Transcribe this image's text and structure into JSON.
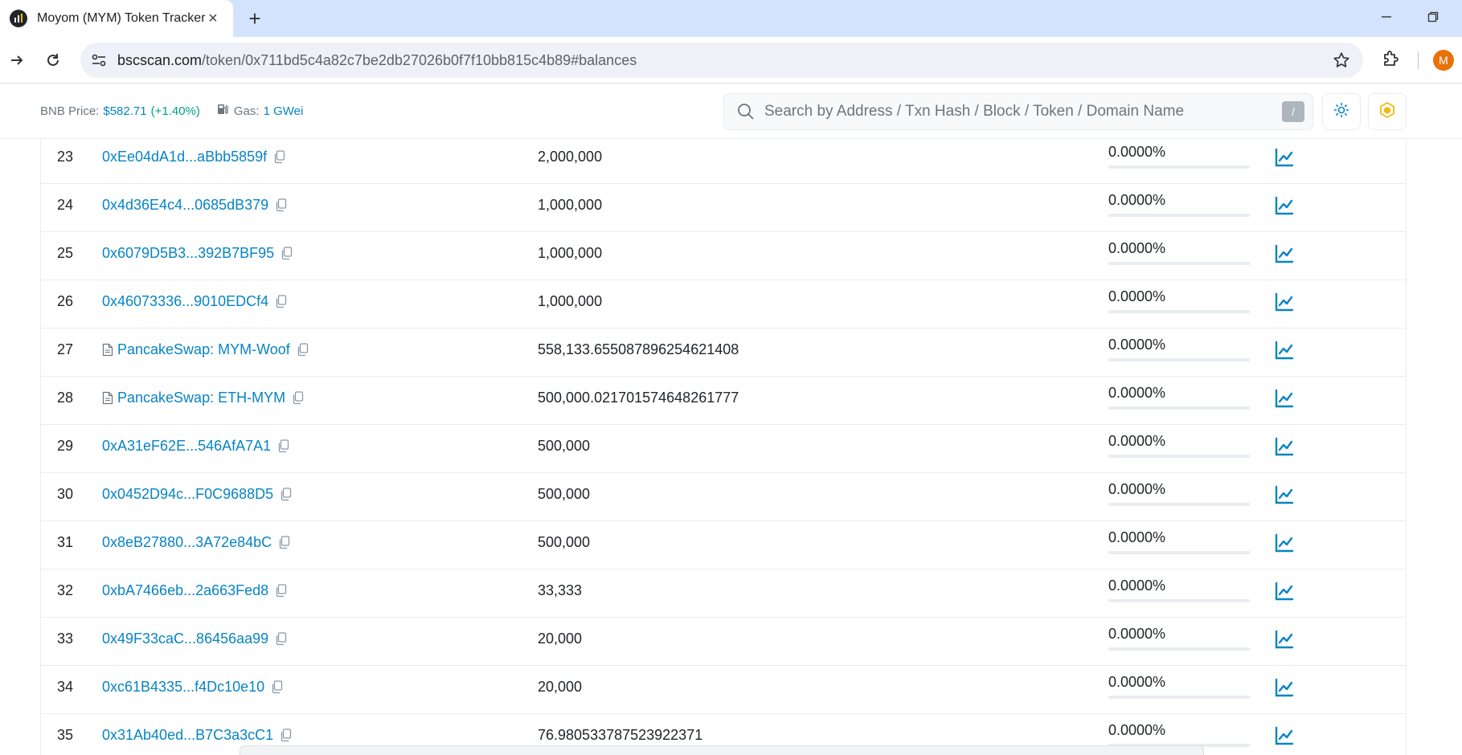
{
  "browser": {
    "tab_title": "Moyom (MYM) Token Tracker | B",
    "url_host": "bscscan.com",
    "url_path": "/token/0x711bd5c4a82c7be2db27026b0f7f10bb815c4b89#balances",
    "profile_initial": "M"
  },
  "header": {
    "bnb_price_label": "BNB Price:",
    "bnb_price_value": "$582.71",
    "bnb_price_change": "(+1.40%)",
    "gas_label": "Gas:",
    "gas_value": "1 GWei",
    "search_placeholder": "Search by Address / Txn Hash / Block / Token / Domain Name",
    "search_shortcut": "/"
  },
  "holders": [
    {
      "rank": "23",
      "address": "0xEe04dA1d...aBbb5859f",
      "is_contract": false,
      "quantity": "2,000,000",
      "percentage": "0.0000%",
      "share": 0
    },
    {
      "rank": "24",
      "address": "0x4d36E4c4...0685dB379",
      "is_contract": false,
      "quantity": "1,000,000",
      "percentage": "0.0000%",
      "share": 0
    },
    {
      "rank": "25",
      "address": "0x6079D5B3...392B7BF95",
      "is_contract": false,
      "quantity": "1,000,000",
      "percentage": "0.0000%",
      "share": 0
    },
    {
      "rank": "26",
      "address": "0x46073336...9010EDCf4",
      "is_contract": false,
      "quantity": "1,000,000",
      "percentage": "0.0000%",
      "share": 0
    },
    {
      "rank": "27",
      "address": "PancakeSwap: MYM-Woof",
      "is_contract": true,
      "quantity": "558,133.655087896254621408",
      "percentage": "0.0000%",
      "share": 0
    },
    {
      "rank": "28",
      "address": "PancakeSwap: ETH-MYM",
      "is_contract": true,
      "quantity": "500,000.021701574648261777",
      "percentage": "0.0000%",
      "share": 0
    },
    {
      "rank": "29",
      "address": "0xA31eF62E...546AfA7A1",
      "is_contract": false,
      "quantity": "500,000",
      "percentage": "0.0000%",
      "share": 0
    },
    {
      "rank": "30",
      "address": "0x0452D94c...F0C9688D5",
      "is_contract": false,
      "quantity": "500,000",
      "percentage": "0.0000%",
      "share": 0
    },
    {
      "rank": "31",
      "address": "0x8eB27880...3A72e84bC",
      "is_contract": false,
      "quantity": "500,000",
      "percentage": "0.0000%",
      "share": 0
    },
    {
      "rank": "32",
      "address": "0xbA7466eb...2a663Fed8",
      "is_contract": false,
      "quantity": "33,333",
      "percentage": "0.0000%",
      "share": 0
    },
    {
      "rank": "33",
      "address": "0x49F33caC...86456aa99",
      "is_contract": false,
      "quantity": "20,000",
      "percentage": "0.0000%",
      "share": 0
    },
    {
      "rank": "34",
      "address": "0xc61B4335...f4Dc10e10",
      "is_contract": false,
      "quantity": "20,000",
      "percentage": "0.0000%",
      "share": 0
    },
    {
      "rank": "35",
      "address": "0x31Ab40ed...B7C3a3cC1",
      "is_contract": false,
      "quantity": "76.980533787523922371",
      "percentage": "0.0000%",
      "share": 0
    }
  ],
  "colors": {
    "link": "#0784c3",
    "positive": "#00a186",
    "tab_strip": "#d3e3fd",
    "bnb_yellow": "#f0b90b"
  },
  "icons": {
    "copy": "copy-icon",
    "contract": "document-icon",
    "analytics": "chart-line-icon"
  }
}
